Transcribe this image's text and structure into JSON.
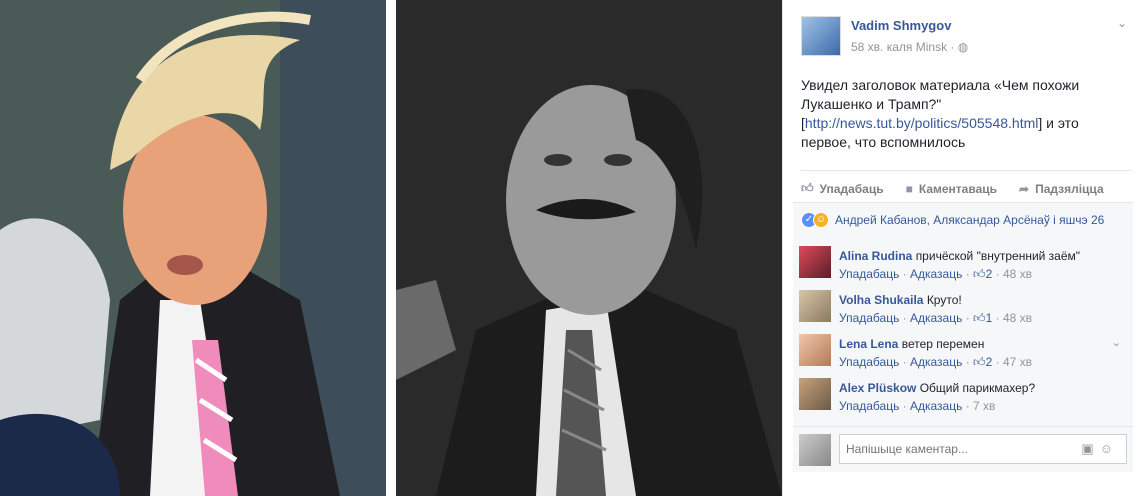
{
  "post": {
    "author": "Vadim Shmygov",
    "meta": "58 хв. каля Minsk · ◍",
    "text_before_link": "Увидел заголовок материала «Чем похожи Лукашенко и Трамп?\" [",
    "link": "http://news.tut.by/politics/505548.html",
    "text_after_link": "] и это первое, что вспомнилось"
  },
  "actions": {
    "like": "Упадабаць",
    "comment": "Каментаваць",
    "share": "Падзяліцца"
  },
  "reactions": {
    "summary": "Андрей Кабанов, Аляксандар Арсёнаў і яшчэ 26"
  },
  "comments": [
    {
      "name": "Alina Rudina",
      "text": "причёской \"внутренний заём\"",
      "like": "Упадабаць",
      "reply": "Адказаць",
      "likes": "2",
      "time": "48 хв"
    },
    {
      "name": "Volha Shukaila",
      "text": "Круто!",
      "like": "Упадабаць",
      "reply": "Адказаць",
      "likes": "1",
      "time": "48 хв"
    },
    {
      "name": "Lena Lena",
      "text": "ветер перемен",
      "like": "Упадабаць",
      "reply": "Адказаць",
      "likes": "2",
      "time": "47 хв"
    },
    {
      "name": "Alex Plüskow",
      "text": "Общий парикмахер?",
      "like": "Упадабаць",
      "reply": "Адказаць",
      "likes": "",
      "time": "7 хв"
    }
  ],
  "write_comment": {
    "placeholder": "Напішыце каментар..."
  },
  "colors": {
    "link": "#365899",
    "muted": "#90949c",
    "panel_bg": "#f6f7f9",
    "tie_pink": "#f08cbc"
  },
  "icons": [
    "chevron-down-icon",
    "globe-icon",
    "like-icon",
    "comment-icon",
    "share-icon",
    "camera-icon",
    "smiley-icon",
    "haha-reaction-icon"
  ]
}
